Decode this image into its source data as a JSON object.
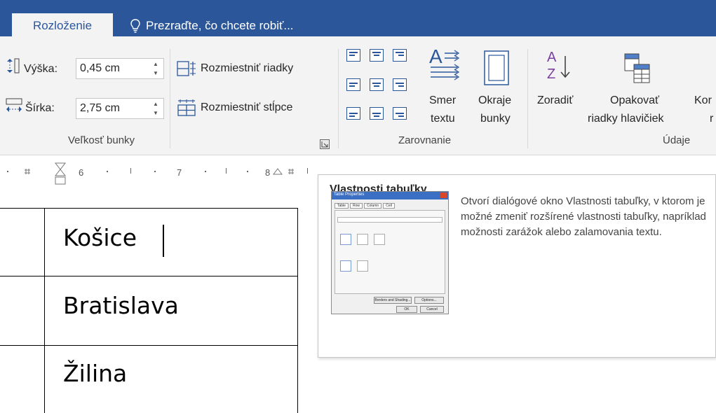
{
  "tabs": {
    "active": "Rozloženie",
    "tell_me": "Prezraďte, čo chcete robiť..."
  },
  "cell_size_group": {
    "label": "Veľkosť bunky",
    "height_label": "Výška:",
    "height_value": "0,45 cm",
    "width_label": "Šírka:",
    "width_value": "2,75 cm",
    "distribute_rows": "Rozmiestniť riadky",
    "distribute_columns": "Rozmiestniť stĺpce"
  },
  "alignment_group": {
    "label": "Zarovnanie",
    "text_direction_line1": "Smer",
    "text_direction_line2": "textu",
    "cell_margins_line1": "Okraje",
    "cell_margins_line2": "bunky"
  },
  "data_group": {
    "label": "Údaje",
    "sort": "Zoradiť",
    "repeat_header_line1": "Opakovať",
    "repeat_header_line2": "riadky hlavičiek",
    "convert_partial_1": "Kor",
    "convert_partial_2": "r"
  },
  "ruler": {
    "ticks": [
      "6",
      "7",
      "8"
    ]
  },
  "table": {
    "cells": [
      "Košice",
      "Bratislava",
      "Žilina"
    ]
  },
  "tooltip": {
    "title": "Vlastnosti tabuľky",
    "description": "Otvorí dialógové okno Vlastnosti tabuľky, v ktorom je možné zmeniť rozšírené vlastnosti tabuľky, napríklad možnosti zarážok alebo zalamovania textu.",
    "preview": {
      "title": "Table Properties",
      "tabs": [
        "Table",
        "Row",
        "Column",
        "Cell"
      ],
      "ok": "OK",
      "cancel": "Cancel",
      "borders": "Borders and Shading...",
      "options": "Options..."
    }
  },
  "colors": {
    "ribbon_blue": "#2b579a",
    "ribbon_bg": "#f3f3f3",
    "sort_az": "#7b3fa0"
  }
}
